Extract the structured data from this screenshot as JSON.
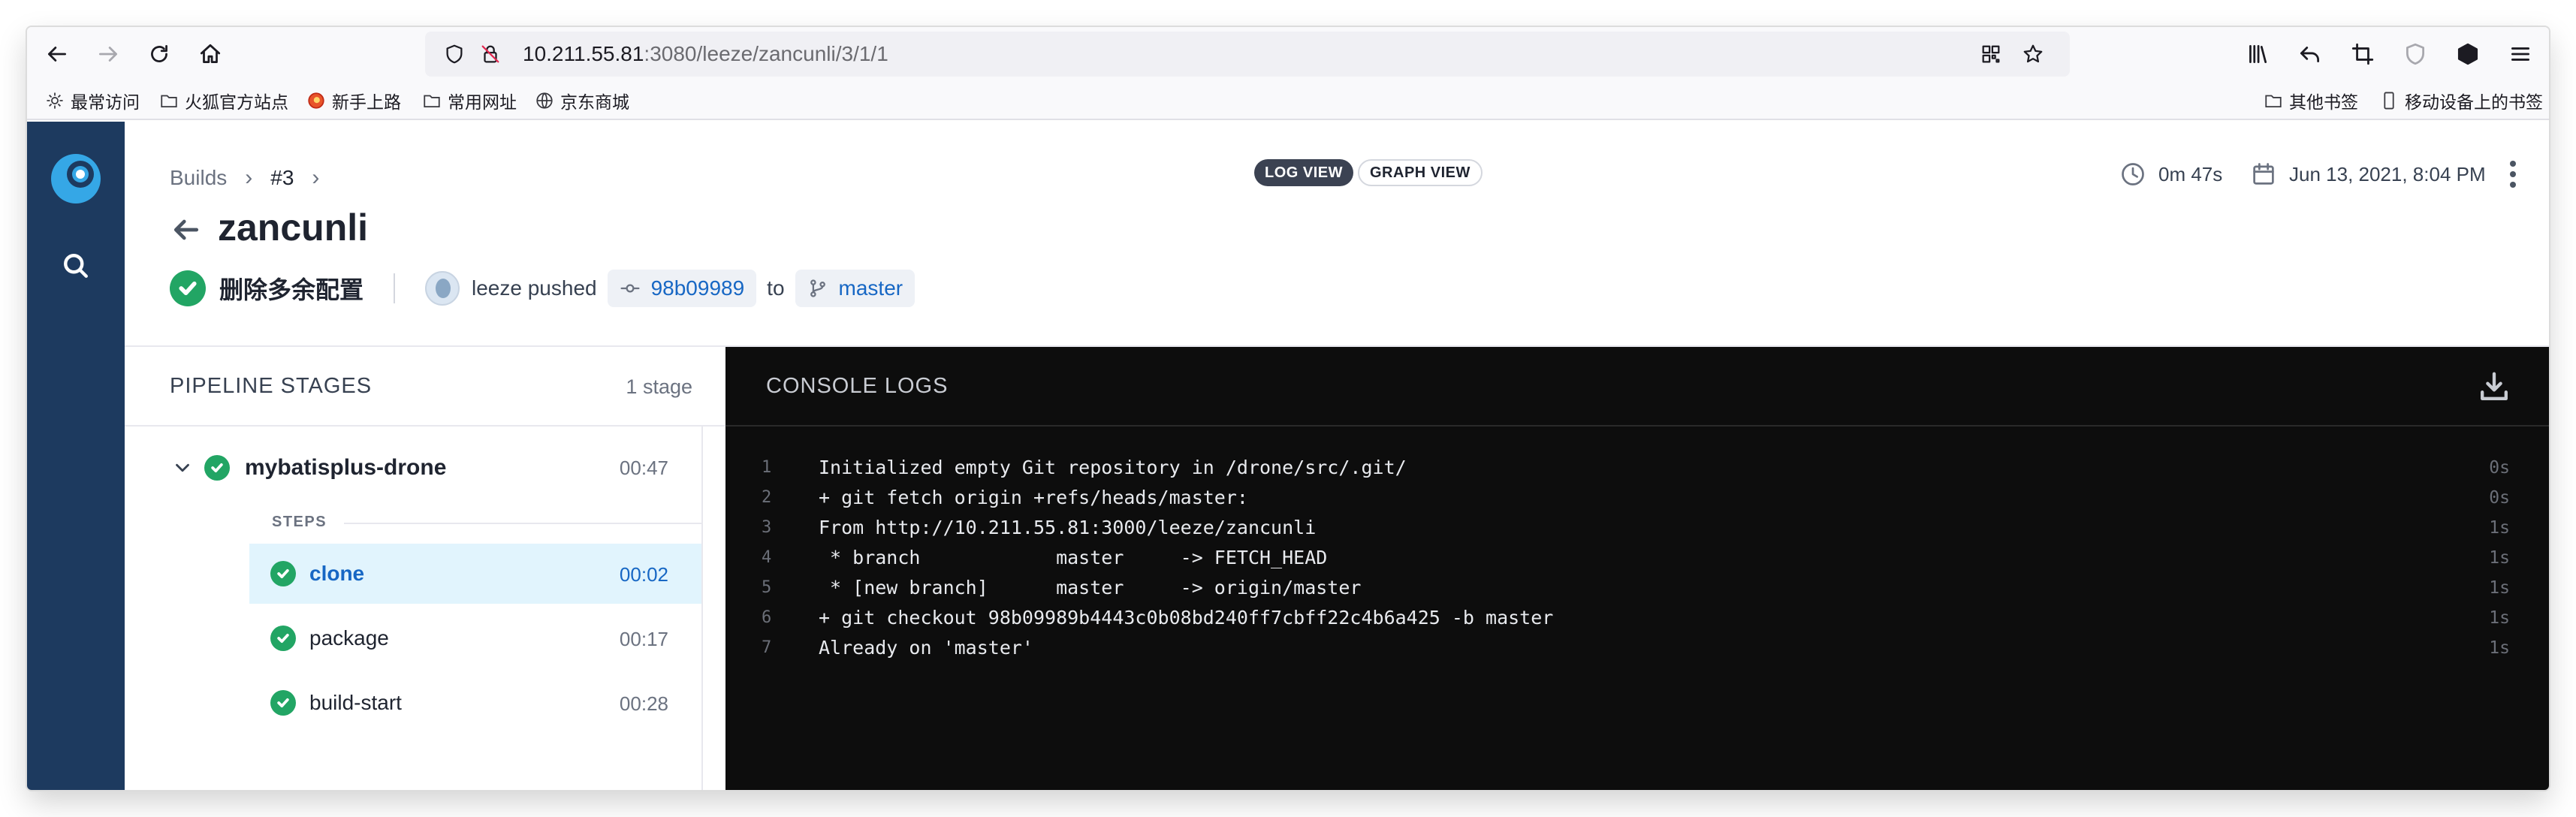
{
  "browser": {
    "url_host": "10.211.55.81",
    "url_rest": ":3080/leeze/zancunli/3/1/1"
  },
  "bookmarks": {
    "items": [
      "最常访问",
      "火狐官方站点",
      "新手上路",
      "常用网址",
      "京东商城"
    ],
    "right_items": [
      "其他书签",
      "移动设备上的书签"
    ]
  },
  "header": {
    "breadcrumb": {
      "builds": "Builds",
      "build_number": "#3"
    },
    "title": "zancunli",
    "view_toggle": {
      "log": "LOG VIEW",
      "graph": "GRAPH VIEW"
    },
    "duration": "0m 47s",
    "date": "Jun 13, 2021, 8:04 PM",
    "commit": {
      "message": "删除多余配置",
      "author_action": "leeze pushed",
      "sha": "98b09989",
      "to": "to",
      "branch": "master"
    }
  },
  "stages": {
    "title": "PIPELINE STAGES",
    "count": "1 stage",
    "stage": {
      "name": "mybatisplus-drone",
      "time": "00:47"
    },
    "steps_label": "STEPS",
    "steps": [
      {
        "name": "clone",
        "time": "00:02"
      },
      {
        "name": "package",
        "time": "00:17"
      },
      {
        "name": "build-start",
        "time": "00:28"
      }
    ]
  },
  "console": {
    "title": "CONSOLE LOGS",
    "lines": [
      {
        "no": "1",
        "text": "Initialized empty Git repository in /drone/src/.git/",
        "time": "0s"
      },
      {
        "no": "2",
        "text": "+ git fetch origin +refs/heads/master:",
        "time": "0s"
      },
      {
        "no": "3",
        "text": "From http://10.211.55.81:3000/leeze/zancunli",
        "time": "1s"
      },
      {
        "no": "4",
        "text": " * branch            master     -> FETCH_HEAD",
        "time": "1s"
      },
      {
        "no": "5",
        "text": " * [new branch]      master     -> origin/master",
        "time": "1s"
      },
      {
        "no": "6",
        "text": "+ git checkout 98b09989b4443c0b08bd240ff7cbff22c4b6a425 -b master",
        "time": "1s"
      },
      {
        "no": "7",
        "text": "Already on 'master'",
        "time": "1s"
      }
    ]
  },
  "colors": {
    "sidebar": "#1d3a5f",
    "success": "#22a564",
    "link": "#1767c4",
    "active_step_bg": "#e1f4fd",
    "console_bg": "#0d0d0d"
  }
}
